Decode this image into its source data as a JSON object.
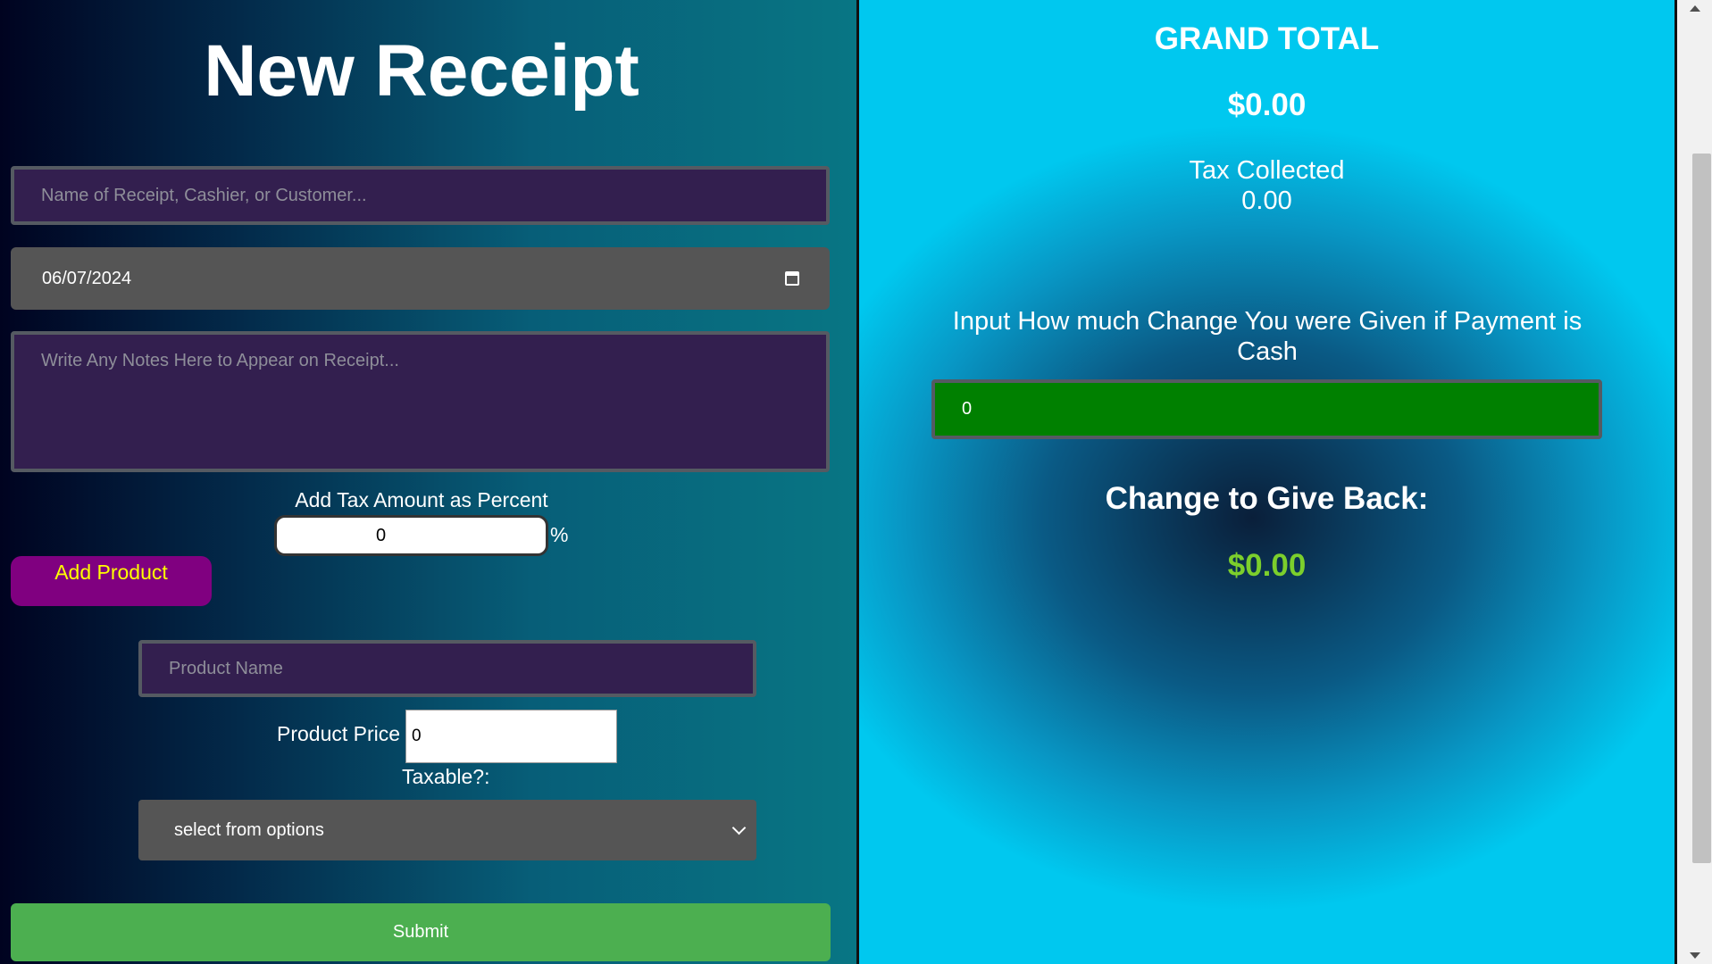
{
  "receipt_form": {
    "title": "New Receipt",
    "name_placeholder": "Name of Receipt, Cashier, or Customer...",
    "date_value": "06/07/2024",
    "notes_placeholder": "Write Any Notes Here to Appear on Receipt...",
    "tax_label": "Add Tax Amount as Percent",
    "tax_value": "0",
    "tax_suffix": "%",
    "add_product_label": "Add Product",
    "product_name_placeholder": "Product Name",
    "product_price_label": "Product Price",
    "product_price_value": "0",
    "taxable_label": "Taxable?:",
    "taxable_select_value": "select from options",
    "submit_label": "Submit"
  },
  "summary": {
    "grand_total_title": "GRAND TOTAL",
    "grand_total_value": "$0.00",
    "tax_collected_label": "Tax Collected",
    "tax_collected_value": "0.00",
    "change_prompt": "Input How much Change You were Given if Payment is Cash",
    "change_input_value": "0",
    "change_back_title": "Change to Give Back:",
    "change_back_value": "$0.00"
  },
  "colors": {
    "add_product_bg": "#800080",
    "add_product_text": "#ffff00",
    "submit_bg": "#4caf50",
    "change_input_bg": "#008000",
    "change_back_value": "#7ccf2c"
  },
  "icons": [
    "calendar-icon",
    "chevron-down-icon",
    "scroll-up-arrow-icon",
    "scroll-down-arrow-icon"
  ]
}
